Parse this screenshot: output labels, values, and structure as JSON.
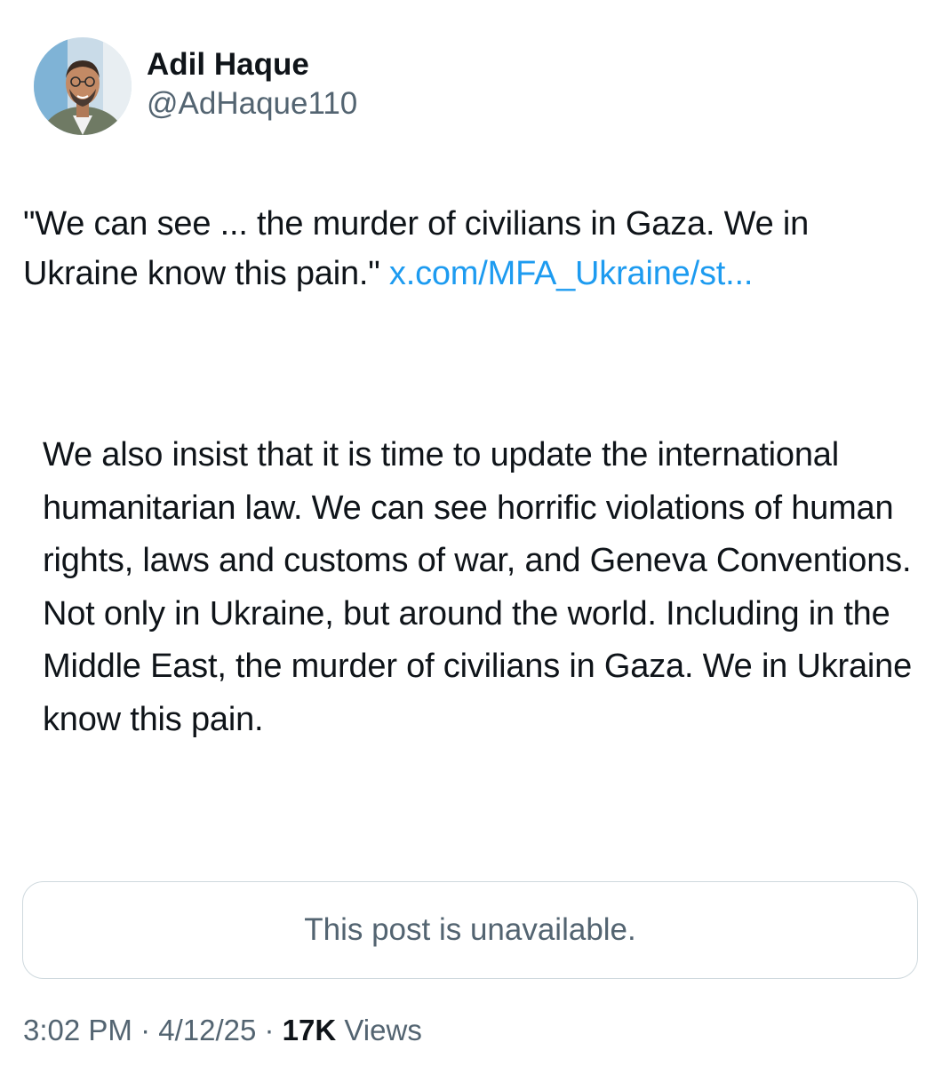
{
  "author": {
    "display_name": "Adil Haque",
    "handle": "@AdHaque110"
  },
  "tweet": {
    "text": "\"We can see ... the murder of civilians in Gaza. We in Ukraine know this pain.\" ",
    "link_text": "x.com/MFA_Ukraine/st..."
  },
  "quote": {
    "text": "We also insist that it is time to update the international humanitarian law. We can see horrific violations of human rights, laws and customs of war, and Geneva Conventions. Not only in Ukraine, but around the world. Including in the Middle East, the murder of civilians in Gaza. We in Ukraine know this pain."
  },
  "unavailable_card": {
    "message": "This post is unavailable."
  },
  "meta": {
    "time": "3:02 PM",
    "separator": " · ",
    "date": "4/12/25",
    "views_count": "17K",
    "views_label": " Views"
  },
  "colors": {
    "link": "#1d9bf0",
    "secondary_text": "#536471",
    "primary_text": "#0f1419",
    "border": "#cfd9de"
  }
}
